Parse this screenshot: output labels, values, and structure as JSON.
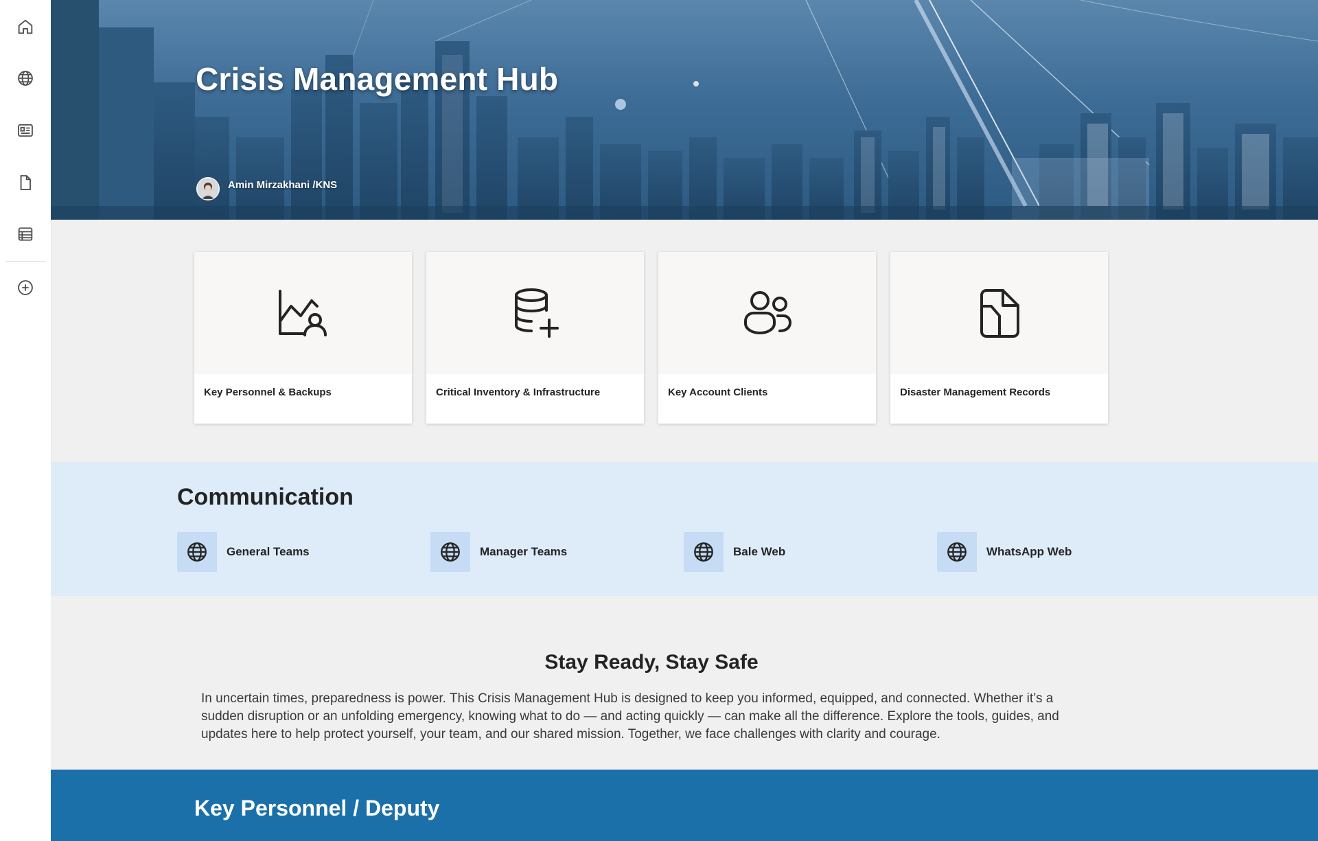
{
  "sidebar": {
    "items": [
      {
        "icon": "home-icon",
        "label": "Home"
      },
      {
        "icon": "globe-icon",
        "label": "Sites"
      },
      {
        "icon": "news-icon",
        "label": "News"
      },
      {
        "icon": "document-icon",
        "label": "Files"
      },
      {
        "icon": "list-icon",
        "label": "Lists"
      },
      {
        "icon": "add-circle-icon",
        "label": "Create"
      }
    ]
  },
  "hero": {
    "title": "Crisis Management Hub",
    "author": "Amin Mirzakhani /KNS"
  },
  "quick_links": [
    {
      "label": "Key Personnel & Backups",
      "icon": "chart-person-icon"
    },
    {
      "label": "Critical Inventory & Infrastructure",
      "icon": "database-add-icon"
    },
    {
      "label": "Key Account Clients",
      "icon": "people-icon"
    },
    {
      "label": "Disaster Management Records",
      "icon": "document-folder-icon"
    }
  ],
  "communication": {
    "title": "Communication",
    "links": [
      {
        "label": "General Teams",
        "icon": "globe-icon"
      },
      {
        "label": "Manager Teams",
        "icon": "globe-icon"
      },
      {
        "label": "Bale Web",
        "icon": "globe-icon"
      },
      {
        "label": "WhatsApp Web",
        "icon": "globe-icon"
      }
    ]
  },
  "intro": {
    "title": "Stay Ready, Stay Safe",
    "body": "In uncertain times, preparedness is power. This Crisis Management Hub is designed to keep you informed, equipped, and connected. Whether it’s a sudden disruption or an unfolding emergency, knowing what to do — and acting quickly — can make all the difference. Explore the tools, guides, and updates here to help protect yourself, your team, and our shared mission. Together, we face challenges with clarity and courage."
  },
  "key_personnel": {
    "title": "Key Personnel / Deputy"
  },
  "colors": {
    "accent": "#1c70aa",
    "communication_bg": "#deecfa",
    "icon_box": "#c6dcf4"
  }
}
